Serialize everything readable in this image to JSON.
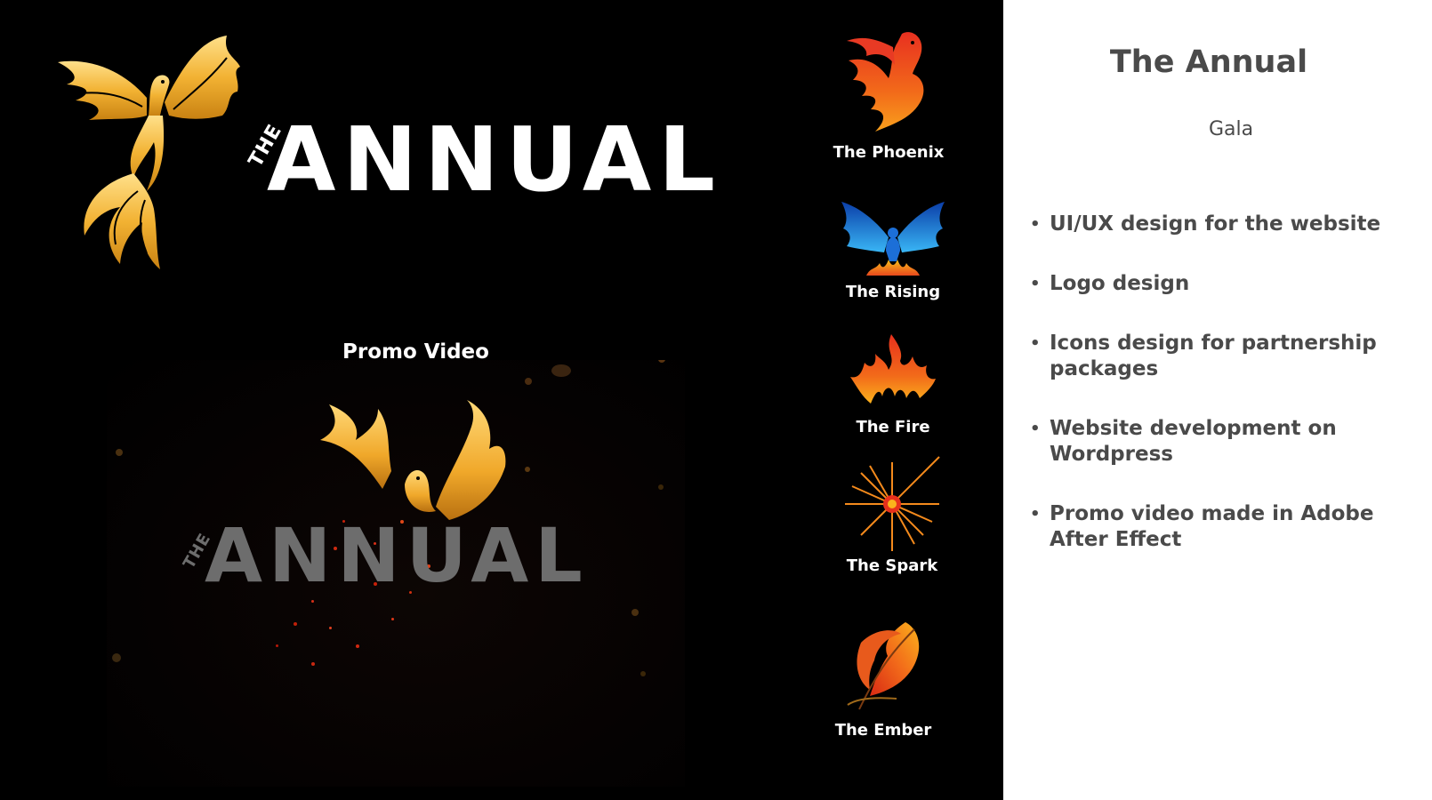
{
  "slide": {
    "title": "The Annual",
    "subtitle": "Gala",
    "logo": {
      "prefix": "THE",
      "wordmark": "ANNUAL"
    },
    "promo": {
      "heading": "Promo Video"
    },
    "packages": [
      {
        "label": "The Phoenix",
        "icon": "phoenix-icon"
      },
      {
        "label": "The Rising",
        "icon": "rising-phoenix-icon"
      },
      {
        "label": "The Fire",
        "icon": "fire-icon"
      },
      {
        "label": "The Spark",
        "icon": "spark-icon"
      },
      {
        "label": "The Ember",
        "icon": "ember-feather-icon"
      }
    ],
    "features": [
      "UI/UX design for the website",
      "Logo design",
      "Icons design for partnership packages",
      "Website development on Wordpress",
      "Promo video made in Adobe After Effect"
    ],
    "colors": {
      "dark_panel": "#000000",
      "light_panel": "#ffffff",
      "gold": "#f2b233",
      "text_dark": "#4a4a4a"
    }
  }
}
